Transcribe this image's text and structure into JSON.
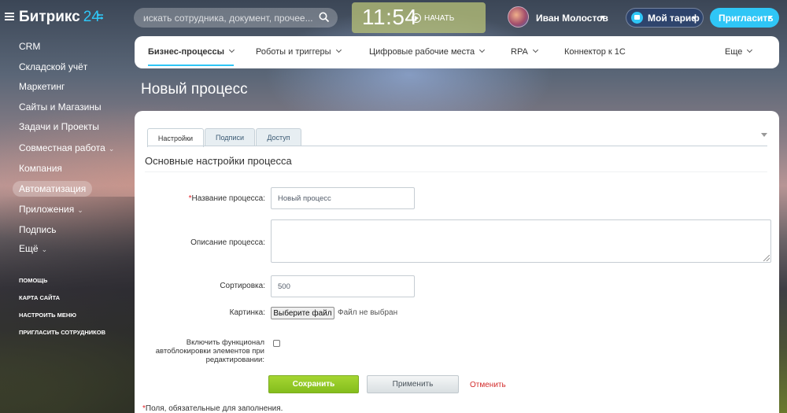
{
  "app": {
    "logo_text": "Битрикс",
    "logo_number": "24"
  },
  "header": {
    "search_placeholder": "искать сотрудника, документ, прочее...",
    "clock": "11:54",
    "start_label": "НАЧАТЬ",
    "user_name": "Иван Молостов",
    "tariff_label": "Мой тариф",
    "invite_label": "Пригласить"
  },
  "sidebar": {
    "items": [
      {
        "label": "CRM"
      },
      {
        "label": "Складской учёт"
      },
      {
        "label": "Маркетинг"
      },
      {
        "label": "Сайты и Магазины"
      },
      {
        "label": "Задачи и Проекты"
      },
      {
        "label": "Совместная работа"
      },
      {
        "label": "Компания"
      },
      {
        "label": "Автоматизация"
      },
      {
        "label": "Приложения"
      },
      {
        "label": "Подпись"
      },
      {
        "label": "Ещё"
      }
    ],
    "footer_links": [
      {
        "label": "ПОМОЩЬ"
      },
      {
        "label": "КАРТА САЙТА"
      },
      {
        "label": "НАСТРОИТЬ МЕНЮ"
      },
      {
        "label": "ПРИГЛАСИТЬ СОТРУДНИКОВ"
      }
    ]
  },
  "subnav": {
    "items": [
      {
        "label": "Бизнес-процессы"
      },
      {
        "label": "Роботы и триггеры"
      },
      {
        "label": "Цифровые рабочие места"
      },
      {
        "label": "RPA"
      },
      {
        "label": "Коннектор к 1С"
      },
      {
        "label": "Еще"
      }
    ]
  },
  "page": {
    "title": "Новый процесс"
  },
  "form": {
    "tabs": [
      {
        "label": "Настройки"
      },
      {
        "label": "Подписи"
      },
      {
        "label": "Доступ"
      }
    ],
    "section_title": "Основные настройки процесса",
    "name_label": "Название процесса:",
    "name_required_mark": "*",
    "name_value": "Новый процесс",
    "description_label": "Описание процесса:",
    "description_value": "",
    "sort_label": "Сортировка:",
    "sort_value": "500",
    "image_label": "Картинка:",
    "file_button": "Выберите файл",
    "file_status": "Файл не выбран",
    "autolock_label": "Включить функционал автоблокировки элементов при редактировании:",
    "autolock_checked": false,
    "save_button": "Сохранить",
    "apply_button": "Применить",
    "cancel_link": "Отменить",
    "required_mark": "*",
    "required_note": "Поля, обязательные для заполнения."
  },
  "colors": {
    "accent": "#2fc6f6",
    "save_green": "#9dcf2e",
    "cancel_red": "#d32b2b"
  }
}
